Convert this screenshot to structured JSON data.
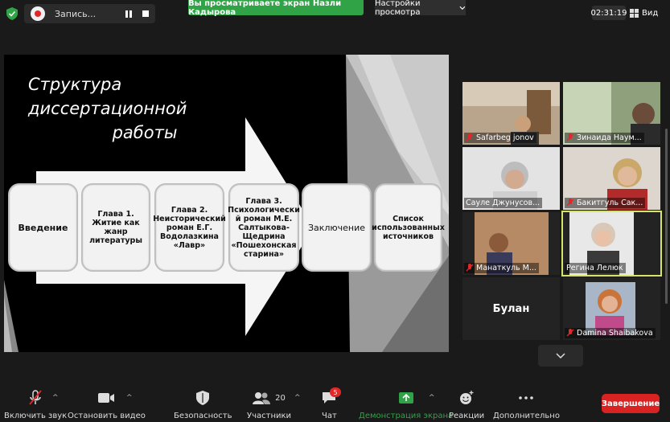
{
  "topbar": {
    "recording_label": "Запись...",
    "share_banner": "Вы просматриваете экран Назли Кадырова",
    "view_settings": "Настройки просмотра",
    "timer": "02:31:19",
    "view_label": "Вид"
  },
  "slide": {
    "title_line1": "Структура диссертационной",
    "title_line2": "работы",
    "boxes": [
      "Введение",
      "Глава 1. Житие как жанр литературы",
      "Глава 2. Неисторический роман Е.Г. Водолазкина «Лавр»",
      "Глава 3. Психологический роман М.Е. Салтыкова-Щедрина «Пошехонская старина»",
      "Заключение",
      "Список использованных источников"
    ],
    "box3_html": "Глава 3. Психологически й роман М.Е. Салтыкова-Щедрина «Пошехонская старина»"
  },
  "participants": [
    {
      "name": "Safarbeg jonov",
      "muted": true
    },
    {
      "name": "Зинаида Наум...",
      "muted": true
    },
    {
      "name": "Сауле Джунусов...",
      "muted": false
    },
    {
      "name": "Бакитгуль Сак...",
      "muted": true
    },
    {
      "name": "Манаткуль М...",
      "muted": true
    },
    {
      "name": "Регина Лелюк",
      "muted": false
    },
    {
      "name": "Булан",
      "muted": true
    },
    {
      "name": "Damina Shaibakova",
      "muted": true
    }
  ],
  "toolbar": {
    "mute_label": "Включить звук",
    "video_label": "Остановить видео",
    "security_label": "Безопасность",
    "participants_label": "Участники",
    "participants_count": "20",
    "chat_label": "Чат",
    "chat_badge": "5",
    "share_label": "Демонстрация экрана",
    "reactions_label": "Реакции",
    "more_label": "Дополнительно",
    "end_label": "Завершение"
  },
  "colors": {
    "share_green": "#2fa346",
    "end_red": "#d92323",
    "active_border": "#d7e46a"
  }
}
